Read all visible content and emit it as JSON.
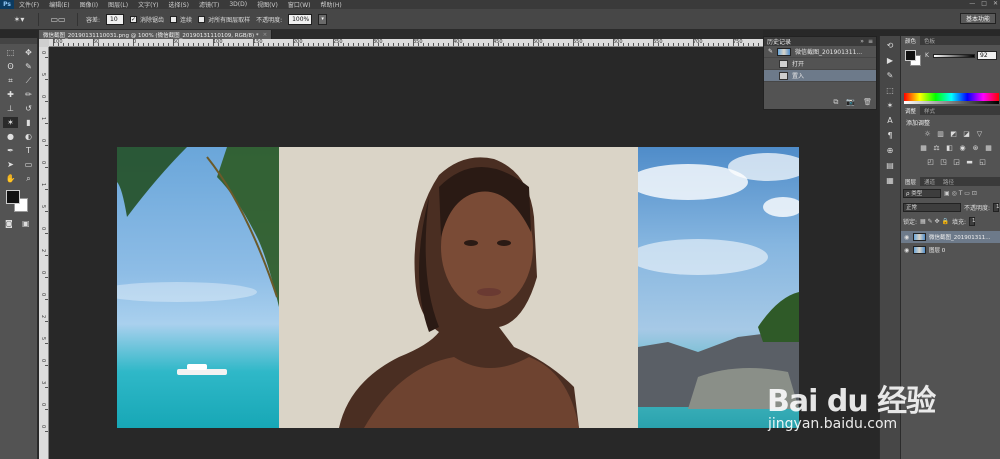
{
  "app": {
    "logo": "Ps"
  },
  "menu": [
    "文件(F)",
    "编辑(E)",
    "图像(I)",
    "图层(L)",
    "文字(Y)",
    "选择(S)",
    "滤镜(T)",
    "3D(D)",
    "视图(V)",
    "窗口(W)",
    "帮助(H)"
  ],
  "window_buttons": {
    "min": "—",
    "max": "□",
    "close": "✕"
  },
  "options": {
    "tolerance_label": "容差:",
    "tolerance_value": "10",
    "antialias_label": "消除锯齿",
    "contiguous_label": "连续",
    "sample_all_label": "对所有图层取样",
    "opacity_label": "不透明度:",
    "opacity_value": "100%",
    "workspace": "基本功能"
  },
  "doc_tab": {
    "label": "微信截图_20190131110031.png @ 100% (微信截图_20190131110109, RGB/8) *",
    "close": "×"
  },
  "ruler": {
    "h_labels": [
      "100",
      "50",
      "0",
      "50",
      "100",
      "150",
      "200",
      "250",
      "300",
      "350",
      "400",
      "450",
      "500",
      "550",
      "600",
      "650",
      "700",
      "750"
    ],
    "v_labels": [
      "0",
      "5",
      "0",
      "1",
      "0",
      "0",
      "1",
      "5",
      "0",
      "2",
      "0",
      "0",
      "2",
      "5",
      "0",
      "3",
      "0",
      "0"
    ]
  },
  "history": {
    "title": "历史记录",
    "collapse": "»",
    "menu": "≡",
    "snapshot": "微信截图_201901311...",
    "items": [
      "打开",
      "置入"
    ],
    "footer_icons": [
      "⧉",
      "📷",
      "🗑"
    ]
  },
  "panels": {
    "color_tabs": [
      "颜色",
      "色板"
    ],
    "k_label": "K",
    "k_value": "92",
    "adjust_tabs": [
      "调整",
      "样式"
    ],
    "adjust_subtitle": "添加调整",
    "layer_tabs": [
      "图层",
      "通道",
      "路径"
    ],
    "kind_label": "ρ 类型",
    "blend_mode": "正常",
    "opacity_label": "不透明度:",
    "opacity_value": "1",
    "lock_label": "锁定:",
    "fill_label": "填充:",
    "fill_value": "1",
    "layers": [
      "微信截图_201901311...",
      "图层 0"
    ]
  },
  "watermark": {
    "logo": "Bai du 经验",
    "url": "jingyan.baidu.com"
  },
  "colors": {
    "menubar": "#3a3a3a",
    "optionsbar": "#474747",
    "panel": "#535353",
    "canvas": "#282828",
    "selection": "#6d7a8a"
  }
}
